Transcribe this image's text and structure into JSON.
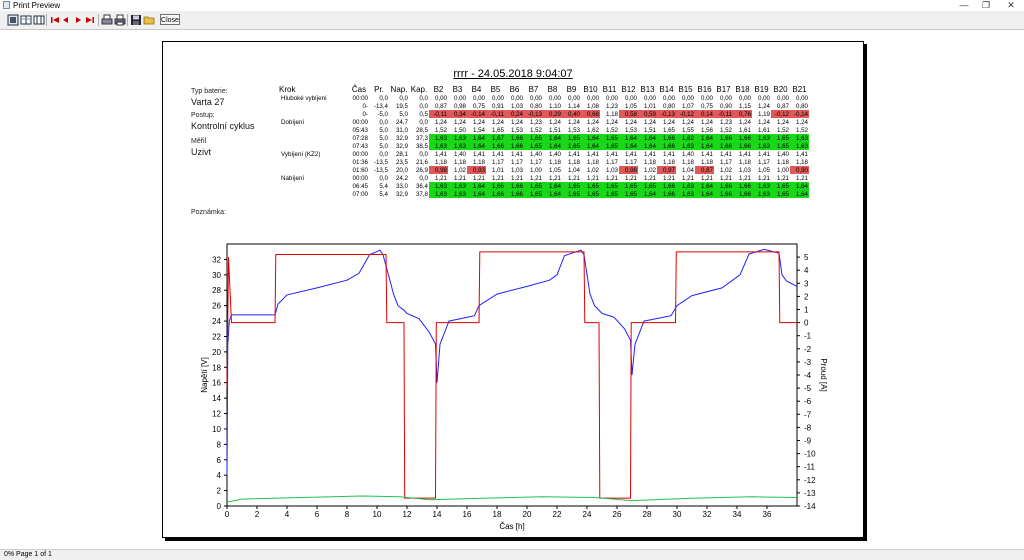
{
  "window": {
    "title": "Print Preview"
  },
  "toolbar": {
    "buttons": [
      {
        "name": "one-page-icon",
        "glyph": "▯"
      },
      {
        "name": "two-pages-icon",
        "glyph": "▯"
      },
      {
        "name": "multi-page-icon",
        "glyph": "▦"
      },
      {
        "name": "first-page-icon",
        "glyph": "⏮"
      },
      {
        "name": "prev-page-icon",
        "glyph": "◀"
      },
      {
        "name": "next-page-icon",
        "glyph": "▶"
      },
      {
        "name": "last-page-icon",
        "glyph": "⏭"
      },
      {
        "name": "print-setup-icon",
        "glyph": "⎙"
      },
      {
        "name": "print-icon",
        "glyph": "⎙"
      },
      {
        "name": "save-icon",
        "glyph": "💾"
      },
      {
        "name": "open-icon",
        "glyph": "📂"
      }
    ],
    "close_label": "Close"
  },
  "report": {
    "title": "rrrr - 24.05.2018 9:04:07",
    "battery_type_label": "Typ baterie:",
    "battery_type": "Varta 27",
    "procedure_label": "Postup:",
    "procedure": "Kontrolní cyklus",
    "measured_by_label": "Měřil",
    "measured_by": "Uzivt",
    "note_label": "Poznámka:"
  },
  "table": {
    "headers": [
      "Krok",
      "Čas",
      "Pr.",
      "Nap.",
      "Kap.",
      "B2",
      "B3",
      "B4",
      "B5",
      "B6",
      "B7",
      "B8",
      "B9",
      "B10",
      "B11",
      "B12",
      "B13",
      "B14",
      "B15",
      "B16",
      "B17",
      "B18",
      "B19",
      "B20",
      "B21"
    ],
    "rows": [
      {
        "krok": "Hluboké vybíjení",
        "cas": "00:00",
        "pr": "0,0",
        "nap": "0,0",
        "kap": "0,0",
        "cells": [
          "0,00",
          "0,00",
          "0,00",
          "0,00",
          "0,00",
          "0,00",
          "0,00",
          "0,00",
          "0,00",
          "0,00",
          "0,00",
          "0,00",
          "0,00",
          "0,00",
          "0,00",
          "0,00",
          "0,00",
          "0,00",
          "0,00",
          "0,00"
        ],
        "colors": ""
      },
      {
        "krok": "",
        "cas": "0-",
        "pr": "-13,4",
        "nap": "19,5",
        "kap": "0,0",
        "cells": [
          "0,87",
          "0,98",
          "0,75",
          "0,91",
          "1,03",
          "0,80",
          "1,10",
          "1,14",
          "1,08",
          "1,23",
          "1,05",
          "1,01",
          "0,80",
          "1,07",
          "0,75",
          "0,90",
          "1,15",
          "1,24",
          "0,87",
          "0,80"
        ],
        "colors": ""
      },
      {
        "krok": "",
        "cas": "0-",
        "pr": "-5,0",
        "nap": "5,0",
        "kap": "0,5",
        "cells": [
          "-0,11",
          "0,34",
          "-0,14",
          "-0,11",
          "0,24",
          "-0,13",
          "0,29",
          "0,40",
          "0,68",
          "1,18",
          "0,58",
          "0,59",
          "-0,13",
          "-0,12",
          "0,14",
          "-0,11",
          "0,76",
          "1,19",
          "-0,12",
          "-0,14"
        ],
        "colors": "rrrrrrrrr.rrrrrrr.rr"
      },
      {
        "krok": "Dobíjení",
        "cas": "00:00",
        "pr": "0,0",
        "nap": "24,7",
        "kap": "0,0",
        "cells": [
          "1,24",
          "1,24",
          "1,24",
          "1,24",
          "1,24",
          "1,23",
          "1,24",
          "1,24",
          "1,24",
          "1,24",
          "1,24",
          "1,24",
          "1,24",
          "1,24",
          "1,24",
          "1,23",
          "1,24",
          "1,24",
          "1,24",
          "1,24"
        ],
        "colors": ""
      },
      {
        "krok": "",
        "cas": "05:43",
        "pr": "5,0",
        "nap": "31,0",
        "kap": "28,5",
        "cells": [
          "1,52",
          "1,50",
          "1,54",
          "1,65",
          "1,53",
          "1,52",
          "1,51",
          "1,53",
          "1,62",
          "1,52",
          "1,53",
          "1,51",
          "1,65",
          "1,55",
          "1,56",
          "1,52",
          "1,61",
          "1,61",
          "1,52",
          "1,52"
        ],
        "colors": ""
      },
      {
        "krok": "",
        "cas": "07:28",
        "pr": "5,0",
        "nap": "32,9",
        "kap": "37,3",
        "cells": [
          "1,63",
          "1,63",
          "1,64",
          "1,67",
          "1,66",
          "1,65",
          "1,64",
          "1,65",
          "1,64",
          "1,65",
          "1,64",
          "1,64",
          "1,66",
          "1,62",
          "1,64",
          "1,66",
          "1,66",
          "1,63",
          "1,65",
          "1,63"
        ],
        "colors": "gggggggggggggggggggg"
      },
      {
        "krok": "",
        "cas": "07:43",
        "pr": "5,0",
        "nap": "32,9",
        "kap": "38,5",
        "cells": [
          "1,63",
          "1,63",
          "1,64",
          "1,66",
          "1,66",
          "1,65",
          "1,64",
          "1,65",
          "1,64",
          "1,65",
          "1,64",
          "1,64",
          "1,66",
          "1,63",
          "1,64",
          "1,66",
          "1,66",
          "1,63",
          "1,65",
          "1,63"
        ],
        "colors": "gggggggggggggggggggg"
      },
      {
        "krok": "Vybíjení (KZ2)",
        "cas": "00:00",
        "pr": "0,0",
        "nap": "28,1",
        "kap": "0,0",
        "cells": [
          "1,41",
          "1,40",
          "1,41",
          "1,41",
          "1,41",
          "1,40",
          "1,40",
          "1,41",
          "1,41",
          "1,41",
          "1,41",
          "1,41",
          "1,41",
          "1,40",
          "1,41",
          "1,41",
          "1,41",
          "1,41",
          "1,40",
          "1,41"
        ],
        "colors": ""
      },
      {
        "krok": "",
        "cas": "01:36",
        "pr": "-13,5",
        "nap": "23,5",
        "kap": "21,6",
        "cells": [
          "1,18",
          "1,18",
          "1,18",
          "1,17",
          "1,17",
          "1,17",
          "1,18",
          "1,18",
          "1,18",
          "1,17",
          "1,17",
          "1,18",
          "1,18",
          "1,18",
          "1,18",
          "1,17",
          "1,18",
          "1,17",
          "1,18",
          "1,18"
        ],
        "colors": ""
      },
      {
        "krok": "",
        "cas": "01:60",
        "pr": "-13,5",
        "nap": "20,0",
        "kap": "26,9",
        "cells": [
          "0,98",
          "1,02",
          "0,93",
          "1,01",
          "1,03",
          "1,00",
          "1,05",
          "1,04",
          "1,02",
          "1,03",
          "0,98",
          "1,02",
          "0,97",
          "1,04",
          "0,87",
          "1,02",
          "1,03",
          "1,05",
          "1,00",
          "0,90"
        ],
        "colors": "r.r.......r.r.r....r"
      },
      {
        "krok": "Nabíjení",
        "cas": "00:00",
        "pr": "0,0",
        "nap": "24,2",
        "kap": "0,0",
        "cells": [
          "1,21",
          "1,21",
          "1,21",
          "1,21",
          "1,21",
          "1,21",
          "1,21",
          "1,21",
          "1,21",
          "1,21",
          "1,21",
          "1,21",
          "1,21",
          "1,21",
          "1,21",
          "1,21",
          "1,21",
          "1,21",
          "1,21",
          "1,21"
        ],
        "colors": ""
      },
      {
        "krok": "",
        "cas": "06:45",
        "pr": "5,4",
        "nap": "33,0",
        "kap": "36,4",
        "cells": [
          "1,63",
          "1,63",
          "1,64",
          "1,66",
          "1,66",
          "1,65",
          "1,64",
          "1,65",
          "1,65",
          "1,65",
          "1,65",
          "1,65",
          "1,66",
          "1,63",
          "1,64",
          "1,66",
          "1,66",
          "1,63",
          "1,65",
          "1,64"
        ],
        "colors": "gggggggggggggggggggg"
      },
      {
        "krok": "",
        "cas": "07:00",
        "pr": "5,4",
        "nap": "32,9",
        "kap": "37,8",
        "cells": [
          "1,63",
          "1,63",
          "1,64",
          "1,66",
          "1,66",
          "1,65",
          "1,64",
          "1,65",
          "1,65",
          "1,65",
          "1,65",
          "1,64",
          "1,66",
          "1,63",
          "1,64",
          "1,66",
          "1,66",
          "1,63",
          "1,65",
          "1,64"
        ],
        "colors": "gggggggggggggggggggg"
      }
    ]
  },
  "chart_data": {
    "type": "line",
    "xlabel": "Čas [h]",
    "ylabel": "Napětí [V]",
    "y2label": "Proud [A]",
    "xlim": [
      0,
      38
    ],
    "ylim": [
      0,
      34
    ],
    "y2lim": [
      -14,
      6
    ],
    "xticks": [
      0,
      2,
      4,
      6,
      8,
      10,
      12,
      14,
      16,
      18,
      20,
      22,
      24,
      26,
      28,
      30,
      32,
      34,
      36
    ],
    "yticks": [
      0,
      2,
      4,
      6,
      8,
      10,
      12,
      14,
      16,
      18,
      20,
      22,
      24,
      26,
      28,
      30,
      32
    ],
    "y2ticks": [
      5,
      4,
      3,
      2,
      1,
      0,
      -1,
      -2,
      -3,
      -4,
      -5,
      -6,
      -7,
      -8,
      -9,
      -10,
      -11,
      -12,
      -13,
      -14
    ],
    "series": [
      {
        "axis": "y",
        "color": "#2020ff",
        "x": [
          0,
          0.05,
          0.15,
          0.3,
          3.2,
          3.4,
          4,
          6,
          8,
          8.8,
          9.5,
          10.2,
          10.4,
          10.9,
          11.1,
          11.4,
          11.8,
          12,
          12.8,
          13.5,
          13.9,
          14,
          14.2,
          14.8,
          16.5,
          16.8,
          18,
          20,
          21.5,
          22,
          22.5,
          23.6,
          23.8,
          24.2,
          24.5,
          25,
          25.8,
          26.5,
          26.9,
          27,
          27.2,
          27.8,
          29.6,
          30,
          31,
          33,
          34.2,
          34.8,
          35.8,
          36.8,
          37,
          37.3,
          38
        ],
        "y": [
          4,
          21,
          24,
          24.8,
          24.8,
          26.2,
          27.4,
          28.3,
          29.3,
          30.2,
          32.6,
          33.2,
          32.6,
          29,
          27.5,
          26,
          25.4,
          25,
          24.3,
          22.5,
          21,
          16,
          21,
          24,
          24.7,
          26,
          27.5,
          28.5,
          29.3,
          30,
          32.5,
          33.2,
          32.6,
          27.5,
          26,
          25,
          24.5,
          23,
          21.5,
          17,
          21,
          24,
          24.7,
          26,
          27.3,
          28.3,
          30,
          32.7,
          33.3,
          32.8,
          30,
          29.2,
          28.5
        ]
      },
      {
        "axis": "y2",
        "color": "#e00000",
        "x": [
          0,
          0.1,
          0.3,
          3.2,
          3.25,
          10.6,
          10.65,
          11.8,
          11.85,
          13.9,
          13.95,
          16.8,
          16.85,
          23.8,
          23.85,
          24.8,
          24.85,
          26.9,
          26.95,
          29.9,
          29.95,
          36.8,
          36.85,
          38
        ],
        "y": [
          -5,
          5,
          0,
          0,
          5.2,
          5.2,
          0,
          0,
          -13.4,
          -13.4,
          0,
          0,
          5.4,
          5.4,
          0,
          0,
          -13.4,
          -13.4,
          0,
          0,
          5.4,
          5.4,
          0,
          0
        ]
      },
      {
        "axis": "y",
        "color": "#20c050",
        "x": [
          0,
          1,
          5,
          9,
          11.5,
          13.5,
          17,
          21,
          24.5,
          27,
          31,
          35,
          38
        ],
        "y": [
          0.5,
          0.9,
          1.1,
          1.3,
          1.2,
          0.8,
          1,
          1.2,
          1.1,
          0.7,
          1,
          1.2,
          1.1
        ]
      }
    ]
  },
  "status": {
    "text": "0% Page 1 of 1"
  }
}
